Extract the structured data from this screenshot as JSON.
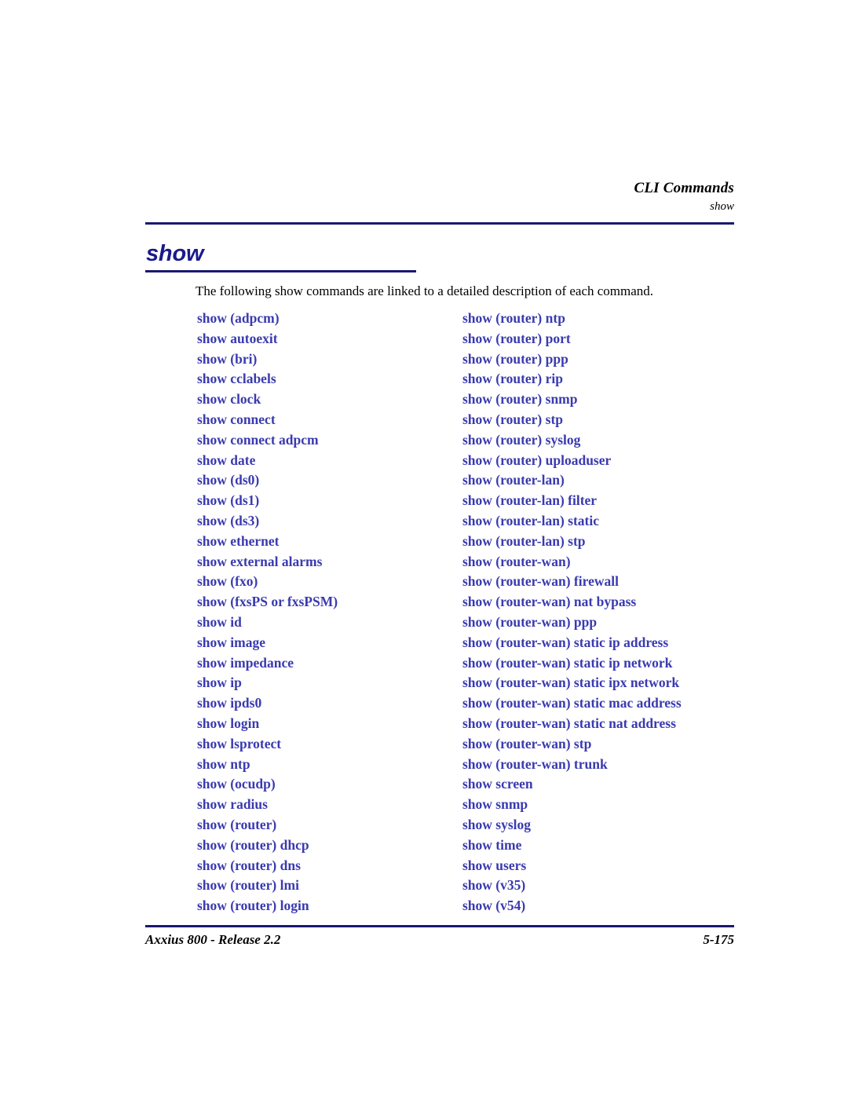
{
  "running_head": {
    "title": "CLI Commands",
    "subtitle": "show"
  },
  "section": {
    "heading": "show",
    "intro": "The following show commands are linked to a detailed description of each command."
  },
  "colors": {
    "rule": "#191970",
    "heading": "#1a1a8c",
    "link": "#3a3ab0",
    "text": "#000000",
    "background": "#ffffff"
  },
  "links": {
    "left_column": [
      "show (adpcm)",
      "show autoexit",
      "show (bri)",
      "show cclabels",
      "show clock",
      "show connect",
      "show connect adpcm",
      "show date",
      "show (ds0)",
      "show (ds1)",
      "show (ds3)",
      "show ethernet",
      "show external alarms",
      "show (fxo)",
      "show (fxsPS or fxsPSM)",
      "show id",
      "show image",
      "show impedance",
      "show ip",
      "show ipds0",
      "show login",
      "show lsprotect",
      "show ntp",
      "show (ocudp)",
      "show radius",
      "show (router)",
      "show (router) dhcp",
      "show (router) dns",
      "show (router) lmi",
      "show (router) login"
    ],
    "right_column": [
      "show (router) ntp",
      "show (router) port",
      "show (router) ppp",
      "show (router) rip",
      "show (router) snmp",
      "show (router) stp",
      "show (router) syslog",
      "show (router) uploaduser",
      "show (router-lan)",
      "show (router-lan) filter",
      "show (router-lan) static",
      "show (router-lan) stp",
      "show (router-wan)",
      "show (router-wan) firewall",
      "show (router-wan) nat bypass",
      "show (router-wan) ppp",
      "show (router-wan) static ip address",
      "show (router-wan) static ip network",
      "show (router-wan) static ipx network",
      "show (router-wan) static mac address",
      "show (router-wan) static nat address",
      "show (router-wan) stp",
      "show (router-wan) trunk",
      "show screen",
      "show snmp",
      "show syslog",
      "show time",
      "show users",
      "show (v35)",
      "show (v54)"
    ]
  },
  "footer": {
    "product": "Axxius 800 - Release 2.2",
    "page_number": "5-175"
  }
}
